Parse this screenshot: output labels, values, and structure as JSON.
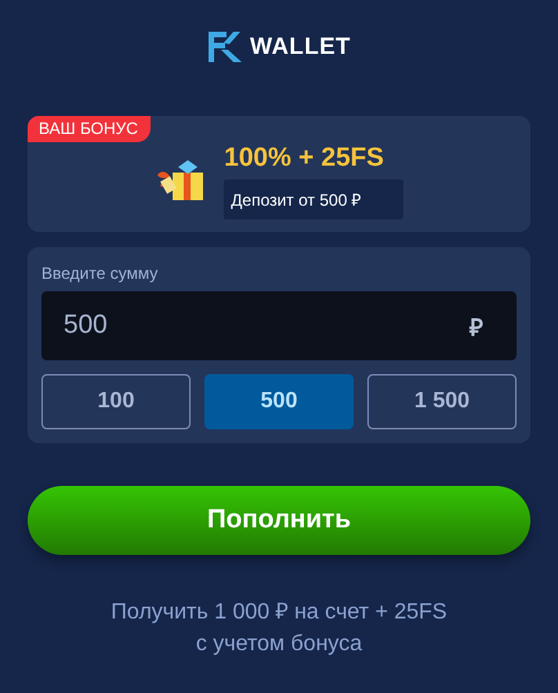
{
  "logo": {
    "text": "WALLET"
  },
  "bonus": {
    "badge": "ВАШ БОНУС",
    "title": "100% + 25FS",
    "subtitle": "Депозит от 500 ₽"
  },
  "amount": {
    "label": "Введите сумму",
    "value": "500",
    "currency": "₽",
    "presets": [
      {
        "label": "100",
        "selected": false
      },
      {
        "label": "500",
        "selected": true
      },
      {
        "label": "1 500",
        "selected": false
      }
    ]
  },
  "submit": "Пополнить",
  "note": [
    "Получить 1 000 ₽ на счет + 25FS",
    "с учетом бонуса"
  ]
}
